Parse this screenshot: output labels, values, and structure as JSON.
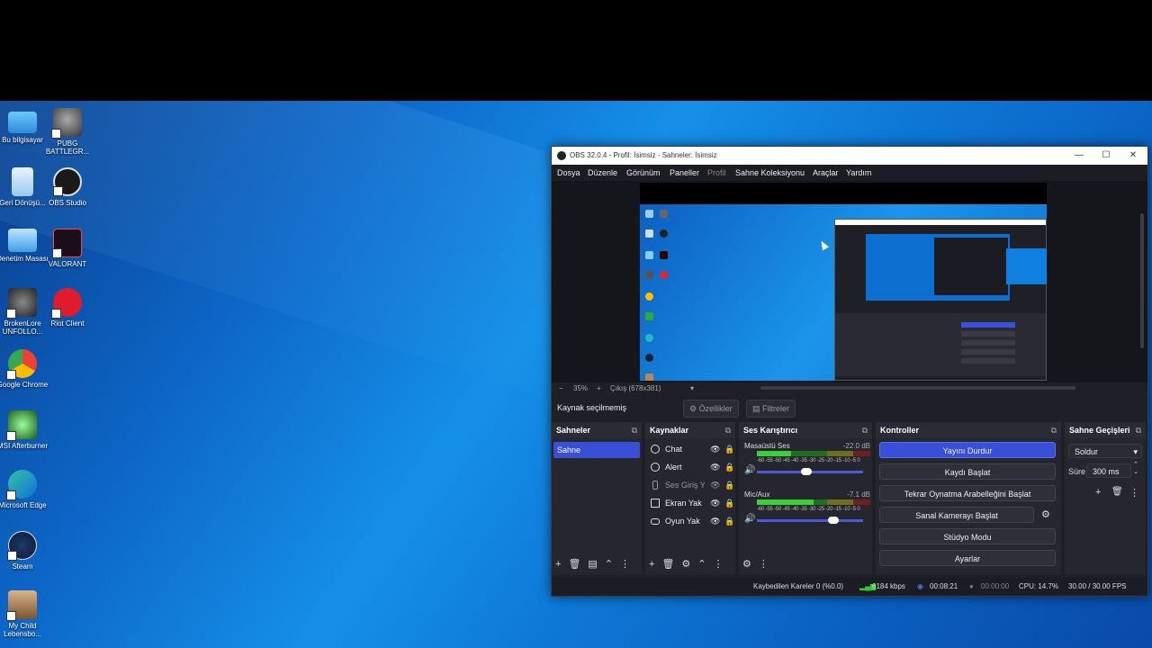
{
  "desktop": {
    "icons": [
      {
        "label": "Bu bilgisayar"
      },
      {
        "label": "PUBG BATTLEGR..."
      },
      {
        "label": "Geri Dönüşü..."
      },
      {
        "label": "OBS Studio"
      },
      {
        "label": "Denetim Masası"
      },
      {
        "label": "VALORANT"
      },
      {
        "label": "BrokenLore UNFOLLO..."
      },
      {
        "label": "Riot Client"
      },
      {
        "label": "Google Chrome"
      },
      {
        "label": "MSI Afterburner"
      },
      {
        "label": "Microsoft Edge"
      },
      {
        "label": "Steam"
      },
      {
        "label": "My Child Lebensbo..."
      }
    ]
  },
  "obs": {
    "title": "OBS 32.0.4 - Profil: İsimsiz - Sahneler: İsimsiz",
    "window_buttons": {
      "minimize": "—",
      "maximize": "☐",
      "close": "✕"
    },
    "menu": [
      "Dosya",
      "Düzenle",
      "Görünüm",
      "Paneller",
      "Profil",
      "Sahne Koleksiyonu",
      "Araçlar",
      "Yardım"
    ],
    "zoom": {
      "minus": "−",
      "percent": "35%",
      "plus": "+",
      "output": "Çıkış (678x381)",
      "arrow": "▾"
    },
    "source_bar": {
      "label": "Kaynak seçilmemiş",
      "properties": "Özellikler",
      "filters": "Filtreler"
    },
    "scenes": {
      "title": "Sahneler",
      "items": [
        "Sahne"
      ]
    },
    "sources": {
      "title": "Kaynaklar",
      "items": [
        {
          "label": "Chat"
        },
        {
          "label": "Alert"
        },
        {
          "label": "Ses Giriş Y"
        },
        {
          "label": "Ekran Yak"
        },
        {
          "label": "Oyun Yak"
        }
      ]
    },
    "mixer": {
      "title": "Ses Karıştırıcı",
      "channels": [
        {
          "name": "Masaüstü Ses",
          "db": "-22.0 dB",
          "level": 0.3,
          "volume": 0.47
        },
        {
          "name": "Mic/Aux",
          "db": "-7.1 dB",
          "level": 0.5,
          "volume": 0.72
        }
      ],
      "ticks": "-60 -55 -50 -45 -40 -35 -30 -25 -20 -15 -10 -5 0"
    },
    "controls": {
      "title": "Kontroller",
      "buttons": [
        "Yayını Durdur",
        "Kaydı Başlat",
        "Tekrar Oynatma Arabelleğini Başlat",
        "Sanal Kamerayı Başlat",
        "Stüdyo Modu",
        "Ayarlar"
      ]
    },
    "transitions": {
      "title": "Sahne Geçişleri",
      "type": "Soldur",
      "duration_label": "Süre",
      "duration": "300 ms"
    },
    "status": {
      "dropped": "Kaybedilen Kareler 0 (%0.0)",
      "bitrate": "6184 kbps",
      "stream_time": "00:08:21",
      "rec_time": "00:00:00",
      "cpu": "CPU: 14.7%",
      "fps": "30.00 / 30.00 FPS"
    }
  }
}
